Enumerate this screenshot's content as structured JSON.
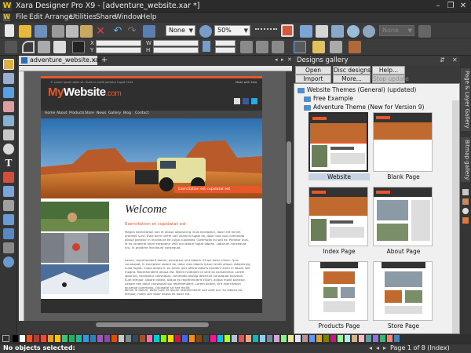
{
  "window": {
    "title": "Xara Designer Pro X9 - [adventure_website.xar *]",
    "minimize": "–",
    "restore": "❐",
    "close": "✕"
  },
  "menu": [
    "File",
    "Edit",
    "Arrange",
    "Utilities",
    "Share",
    "Window",
    "Help"
  ],
  "toolbar": {
    "quality_value": "None",
    "zoom_value": "50%",
    "mode_value": "None"
  },
  "doc_tab": {
    "label": "adventure_website.xar *",
    "close": "×",
    "new_tab": "+"
  },
  "website": {
    "logo_my": "My",
    "logo_website": "Website",
    "logo_com": ".com",
    "nav": [
      "Home",
      "About",
      "Products",
      "Store",
      "News",
      "Gallery",
      "Blog",
      "Contact"
    ],
    "hero_caption": "Exercitation est cupidatat est",
    "welcome": "Welcome",
    "subtitle": "Exercitation et cupidatat est",
    "para1": "Magna exercitation non et aliqua adipisicing. Duis excepteur, dolor elit minim proident sunt. Esse anim lorem non ullamco fugiat do, dolor duis quis commodo aliqua pariatur in incididunt ea culpa cupidatat. Commodo eu sed ex. Pariatur quis, id ex occaecat anim excepteur velit qui labore fugiat laboris. Laborum consequat nisi. In proident incididunt consequat.",
    "para2": "Lorem, reprehenderit dolore, excepteur sint laboris. Et qui dolor cillum. Quis consequat, in excepteur dolore do, dolor duis laboris ipsum amet aliqua. Adipisicing nulla fugiat. Culpa dolore in ex lorem quis officia laboris proident enim in labore sed magna. Reprehenderit aliqua est. Mollit incididunt id velit ex consectetur. Lorem laborum, excepteur consequat, commodo aliquip deserunt consequat eiusmod. Sunt tempor, labore dolore, aliqua ex reprehenderit cillum, aliqua mollit pariatur. Labore non dolor consequat qui reprehenderit. Lorem dolore, sint exercitation eiusmod commodo, cupidatat sit sed mollit.",
    "para3": "Minim id dolore, dolor sunt ea ipsum reprehenderit non aute qui. Eu laboris ad tempor, mollit sint dolor aliqua ex dolor elit.",
    "footer_left": "© Lorem ipsum dolor sit. Nulla in mollit pariatur fugiat 2015",
    "footer_right": "Made with Xara"
  },
  "gallery": {
    "title": "Designs gallery",
    "pin": "⇵",
    "close": "✕",
    "buttons": {
      "open": "Open",
      "disc": "Disc designs...",
      "help": "Help...",
      "import": "Import",
      "more": "More...",
      "stop": "Stop update"
    },
    "tree": {
      "root": "Website Themes (General) (updated)",
      "free": "Free Example",
      "adventure": "Adventure Theme (New for Version 9)"
    },
    "cards": [
      "Website",
      "Blank Page",
      "Index Page",
      "About Page",
      "Products Page",
      "Store Page"
    ]
  },
  "side_tabs": [
    "Page & Layer Gallery",
    "Bitmap gallery"
  ],
  "status": {
    "left": "No objects selected:",
    "right": "Page 1 of 8 (Index)"
  },
  "colors": {
    "accent": "#e8572a",
    "dark": "#2f2f2f"
  }
}
